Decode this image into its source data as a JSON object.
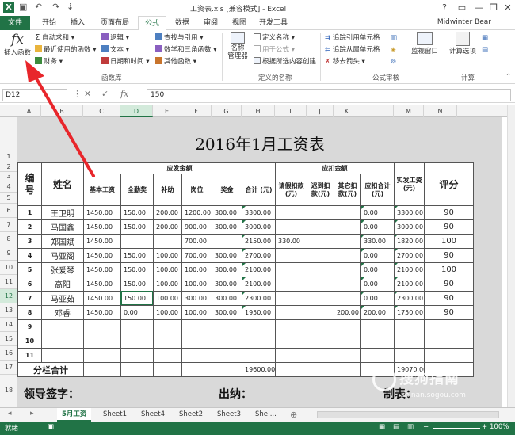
{
  "window": {
    "title": "工资表.xls  [兼容模式] - Excel",
    "user": "Midwinter Bear",
    "app_icon": "X"
  },
  "ribbon_tabs": [
    "文件",
    "开始",
    "插入",
    "页面布局",
    "公式",
    "数据",
    "审阅",
    "视图",
    "开发工具"
  ],
  "ribbon": {
    "insert_function": "插入函数",
    "library": {
      "autosum": "自动求和",
      "recent": "最近使用的函数",
      "finance": "财务",
      "logic": "逻辑",
      "text": "文本",
      "datetime": "日期和时间",
      "lookup": "查找与引用",
      "math": "数学和三角函数",
      "other": "其他函数",
      "group_label": "函数库"
    },
    "names": {
      "manager": "名称\n管理器",
      "define": "定义名称",
      "use_in_formula": "用于公式",
      "create_from_selection": "根据所选内容创建",
      "group_label": "定义的名称"
    },
    "audit": {
      "trace_precedents": "追踪引用单元格",
      "trace_dependents": "追踪从属单元格",
      "remove_arrows": "移去箭头",
      "watch_window": "监视窗口",
      "group_label": "公式审核"
    },
    "calc": {
      "options": "计算选项",
      "group_label": "计算"
    }
  },
  "formula_bar": {
    "name_box": "D12",
    "fx": "fx",
    "value": "150"
  },
  "columns": [
    "A",
    "B",
    "C",
    "D",
    "E",
    "F",
    "G",
    "H",
    "I",
    "J",
    "K",
    "L",
    "M",
    "N"
  ],
  "selected_column": "D",
  "rows": [
    "1",
    "2",
    "3",
    "4",
    "5",
    "6",
    "7",
    "8",
    "9",
    "10",
    "11",
    "12",
    "13",
    "14",
    "15",
    "16",
    "17",
    "18"
  ],
  "selected_row": "12",
  "sheet": {
    "title": "2016年1月工资表",
    "headers": {
      "num": "编\n号",
      "name": "姓名",
      "payable_group": "应发金额",
      "deduct_group": "应扣金额",
      "base": "基本工资",
      "attendance": "全勤奖",
      "allowance": "补助",
      "position": "岗位",
      "bonus": "奖金",
      "total": "合计\n(元)",
      "leave": "请假扣款(元)",
      "late": "迟到扣款(元)",
      "other": "其它扣款(元)",
      "deduct_total": "应扣合计(元)",
      "net": "实发工资(元)",
      "score": "评分"
    },
    "employees": [
      {
        "no": "1",
        "name": "王卫明",
        "base": "1450.00",
        "att": "150.00",
        "allow": "200.00",
        "pos": "1200.00",
        "bonus": "300.00",
        "total": "3300.00",
        "leave": "",
        "late": "",
        "other": "",
        "dtotal": "0.00",
        "net": "3300.00",
        "score": "90"
      },
      {
        "no": "2",
        "name": "马国鑫",
        "base": "1450.00",
        "att": "150.00",
        "allow": "200.00",
        "pos": "900.00",
        "bonus": "300.00",
        "total": "3000.00",
        "leave": "",
        "late": "",
        "other": "",
        "dtotal": "0.00",
        "net": "3000.00",
        "score": "90"
      },
      {
        "no": "3",
        "name": "郑国斌",
        "base": "1450.00",
        "att": "",
        "allow": "",
        "pos": "700.00",
        "bonus": "",
        "total": "2150.00",
        "leave": "330.00",
        "late": "",
        "other": "",
        "dtotal": "330.00",
        "net": "1820.00",
        "score": "100"
      },
      {
        "no": "4",
        "name": "马亚阁",
        "base": "1450.00",
        "att": "150.00",
        "allow": "100.00",
        "pos": "700.00",
        "bonus": "300.00",
        "total": "2700.00",
        "leave": "",
        "late": "",
        "other": "",
        "dtotal": "0.00",
        "net": "2700.00",
        "score": "90"
      },
      {
        "no": "5",
        "name": "张爱琴",
        "base": "1450.00",
        "att": "150.00",
        "allow": "100.00",
        "pos": "100.00",
        "bonus": "300.00",
        "total": "2100.00",
        "leave": "",
        "late": "",
        "other": "",
        "dtotal": "0.00",
        "net": "2100.00",
        "score": "100"
      },
      {
        "no": "6",
        "name": "高阳",
        "base": "1450.00",
        "att": "150.00",
        "allow": "100.00",
        "pos": "100.00",
        "bonus": "300.00",
        "total": "2100.00",
        "leave": "",
        "late": "",
        "other": "",
        "dtotal": "0.00",
        "net": "2100.00",
        "score": "90"
      },
      {
        "no": "7",
        "name": "马亚茹",
        "base": "1450.00",
        "att": "150.00",
        "allow": "100.00",
        "pos": "300.00",
        "bonus": "300.00",
        "total": "2300.00",
        "leave": "",
        "late": "",
        "other": "",
        "dtotal": "0.00",
        "net": "2300.00",
        "score": "90"
      },
      {
        "no": "8",
        "name": "邓睿",
        "base": "1450.00",
        "att": "0.00",
        "allow": "100.00",
        "pos": "100.00",
        "bonus": "300.00",
        "total": "1950.00",
        "leave": "",
        "late": "",
        "other": "200.00",
        "dtotal": "200.00",
        "net": "1750.00",
        "score": "90"
      },
      {
        "no": "9",
        "name": "",
        "base": "",
        "att": "",
        "allow": "",
        "pos": "",
        "bonus": "",
        "total": "",
        "leave": "",
        "late": "",
        "other": "",
        "dtotal": "",
        "net": "",
        "score": ""
      },
      {
        "no": "10",
        "name": "",
        "base": "",
        "att": "",
        "allow": "",
        "pos": "",
        "bonus": "",
        "total": "",
        "leave": "",
        "late": "",
        "other": "",
        "dtotal": "",
        "net": "",
        "score": ""
      },
      {
        "no": "11",
        "name": "",
        "base": "",
        "att": "",
        "allow": "",
        "pos": "",
        "bonus": "",
        "total": "",
        "leave": "",
        "late": "",
        "other": "",
        "dtotal": "",
        "net": "",
        "score": ""
      }
    ],
    "subtotal": {
      "label": "分栏合计",
      "total": "19600.00",
      "net": "19070.00"
    },
    "sign_leader": "领导签字：",
    "sign_cashier": "出纳：",
    "sign_maker": "制表："
  },
  "sheet_tabs": [
    "5月工资",
    "Sheet1",
    "Sheet4",
    "Sheet2",
    "Sheet3",
    "She ..."
  ],
  "status": {
    "ready": "就绪",
    "zoom": "100%"
  },
  "watermark": {
    "main": "搜狗指南",
    "sub": "zhinan.sogou.com"
  },
  "colors": {
    "excel_green": "#217346",
    "arrow_red": "#e8262b"
  }
}
